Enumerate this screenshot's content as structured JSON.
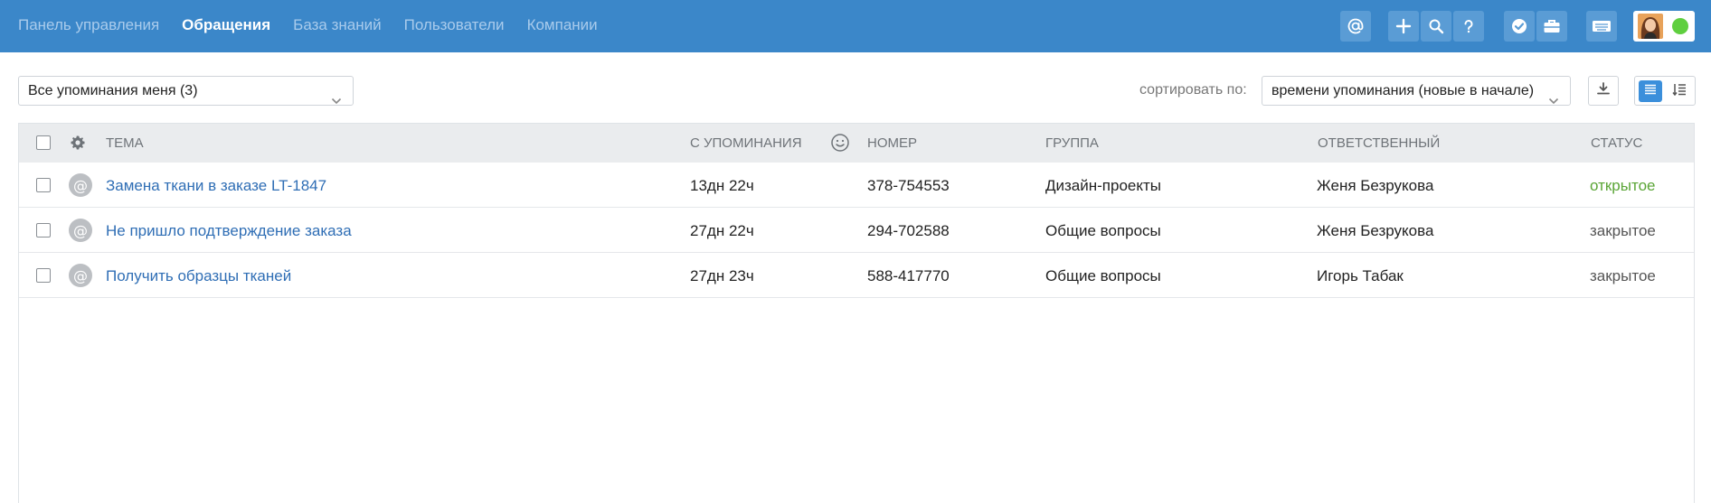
{
  "nav": {
    "items": [
      "Панель управления",
      "Обращения",
      "База знаний",
      "Пользователи",
      "Компании"
    ],
    "active": "Обращения"
  },
  "toolbar_icons": [
    "at-icon",
    "plus-icon",
    "search-icon",
    "help-icon",
    "check-icon",
    "briefcase-icon",
    "keyboard-icon"
  ],
  "filter": {
    "value": "Все упоминания меня (3)"
  },
  "sort": {
    "label": "сортировать по:",
    "value": "времени упоминания (новые в начале)"
  },
  "table": {
    "columns": {
      "subject": "Тема",
      "since_mention": "С упоминания",
      "number": "Номер",
      "group": "Группа",
      "assignee": "Ответственный",
      "status": "Статус"
    },
    "rows": [
      {
        "subject": "Замена ткани в заказе LT-1847",
        "since": "13дн 22ч",
        "number": "378-754553",
        "group": "Дизайн-проекты",
        "assignee": "Женя Безрукова",
        "status": "открытое",
        "status_type": "open"
      },
      {
        "subject": "Не пришло подтверждение заказа",
        "since": "27дн 22ч",
        "number": "294-702588",
        "group": "Общие вопросы",
        "assignee": "Женя Безрукова",
        "status": "закрытое",
        "status_type": "closed"
      },
      {
        "subject": "Получить образцы тканей",
        "since": "27дн 23ч",
        "number": "588-417770",
        "group": "Общие вопросы",
        "assignee": "Игорь Табак",
        "status": "закрытое",
        "status_type": "closed"
      }
    ]
  },
  "colors": {
    "topbar": "#3b87c9",
    "link": "#2f6eb5",
    "status_open": "#5aa536",
    "online": "#5fcf3f"
  }
}
